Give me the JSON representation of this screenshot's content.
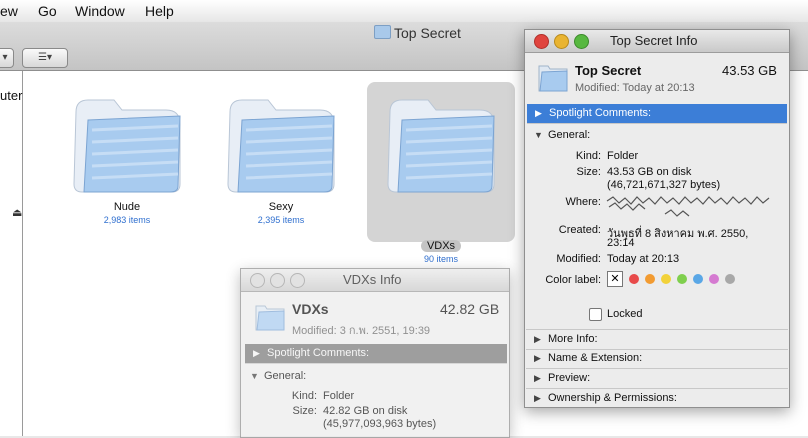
{
  "menubar": {
    "items": [
      "ew",
      "Go",
      "Window",
      "Help"
    ]
  },
  "finder": {
    "title": "Top Secret",
    "sidebar_label": "uter",
    "folders": [
      {
        "name": "Nude",
        "count": "2,983 items",
        "selected": false
      },
      {
        "name": "Sexy",
        "count": "2,395 items",
        "selected": false
      },
      {
        "name": "VDXs",
        "count": "90 items",
        "selected": true
      }
    ]
  },
  "info_top_secret": {
    "title": "Top Secret Info",
    "name": "Top Secret",
    "size": "43.53 GB",
    "modified_line": "Modified: Today at 20:13",
    "spotlight": "Spotlight Comments:",
    "general": "General:",
    "kind_k": "Kind:",
    "kind_v": "Folder",
    "size_k": "Size:",
    "size_v1": "43.53 GB on disk",
    "size_v2": "(46,721,671,327 bytes)",
    "where_k": "Where:",
    "created_k": "Created:",
    "created_v1": "วันพุธที่ 8 สิงหาคม พ.ศ. 2550,",
    "created_v2": "23:14",
    "modified_k": "Modified:",
    "modified_v": "Today at 20:13",
    "color_k": "Color label:",
    "locked": "Locked",
    "more_info": "More Info:",
    "name_ext": "Name & Extension:",
    "preview": "Preview:",
    "ownership": "Ownership & Permissions:"
  },
  "info_vdxs": {
    "title": "VDXs Info",
    "name": "VDXs",
    "size": "42.82 GB",
    "modified_line": "Modified: 3 ก.พ. 2551, 19:39",
    "spotlight": "Spotlight Comments:",
    "general": "General:",
    "kind_k": "Kind:",
    "kind_v": "Folder",
    "size_k": "Size:",
    "size_v1": "42.82 GB on disk",
    "size_v2": "(45,977,093,963 bytes)"
  },
  "colors": {
    "label_colors": [
      "#e84a4a",
      "#f29b31",
      "#f2d23a",
      "#7fcf4d",
      "#5aa7e6",
      "#d57ad1",
      "#a8a8a8"
    ],
    "close": "#e0443e",
    "minimize": "#e9b431",
    "zoom": "#57b840"
  }
}
